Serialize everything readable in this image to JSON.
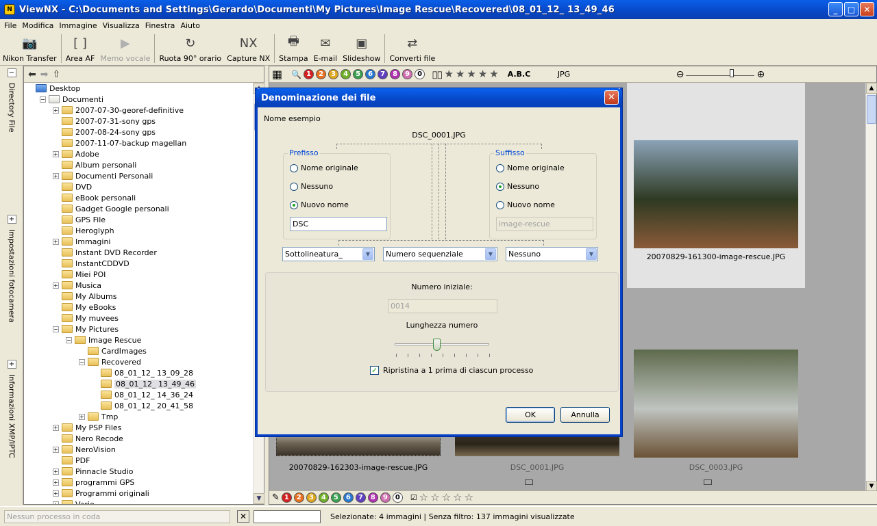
{
  "window": {
    "title": "ViewNX - C:\\Documents and Settings\\Gerardo\\Documenti\\My Pictures\\Image Rescue\\Recovered\\08_01_12_ 13_49_46",
    "app_icon": "N",
    "controls": {
      "minimize": "_",
      "maximize": "□",
      "close": "✕"
    }
  },
  "menu": [
    "File",
    "Modifica",
    "Immagine",
    "Visualizza",
    "Finestra",
    "Aiuto"
  ],
  "toolbar": [
    {
      "label": "Nikon Transfer",
      "icon": "camera-transfer-icon",
      "glyph": "📷",
      "enabled": true
    },
    {
      "label": "Area AF",
      "icon": "af-area-icon",
      "glyph": "[ ]",
      "enabled": true
    },
    {
      "label": "Memo vocale",
      "icon": "voice-memo-icon",
      "glyph": "▶",
      "enabled": false
    },
    {
      "label": "Ruota 90° orario",
      "icon": "rotate-icon",
      "glyph": "↻",
      "enabled": true
    },
    {
      "label": "Capture NX",
      "icon": "capture-nx-icon",
      "glyph": "NX",
      "enabled": true
    },
    {
      "label": "Stampa",
      "icon": "print-icon",
      "glyph": "🖶",
      "enabled": true
    },
    {
      "label": "E-mail",
      "icon": "email-icon",
      "glyph": "✉",
      "enabled": true
    },
    {
      "label": "Slideshow",
      "icon": "slideshow-icon",
      "glyph": "▣",
      "enabled": true
    },
    {
      "label": "Converti file",
      "icon": "convert-file-icon",
      "glyph": "⇄",
      "enabled": true
    }
  ],
  "left_tabs": [
    {
      "label": "Directory File",
      "toggle": "−"
    },
    {
      "label": "Impostazioni fotocamera",
      "toggle": "+"
    },
    {
      "label": "Informazioni XMP/IPTC",
      "toggle": "+"
    }
  ],
  "tree": [
    {
      "level": 0,
      "label": "Desktop",
      "exp": "",
      "icon": "desktop"
    },
    {
      "level": 1,
      "label": "Documenti",
      "exp": "−",
      "icon": "docs"
    },
    {
      "level": 2,
      "label": "2007-07-30-georef-definitive",
      "exp": "+"
    },
    {
      "level": 2,
      "label": "2007-07-31-sony gps",
      "exp": ""
    },
    {
      "level": 2,
      "label": "2007-08-24-sony gps",
      "exp": ""
    },
    {
      "level": 2,
      "label": "2007-11-07-backup magellan",
      "exp": ""
    },
    {
      "level": 2,
      "label": "Adobe",
      "exp": "+"
    },
    {
      "level": 2,
      "label": "Album personali",
      "exp": ""
    },
    {
      "level": 2,
      "label": "Documenti Personali",
      "exp": "+"
    },
    {
      "level": 2,
      "label": "DVD",
      "exp": ""
    },
    {
      "level": 2,
      "label": "eBook personali",
      "exp": ""
    },
    {
      "level": 2,
      "label": "Gadget Google personali",
      "exp": ""
    },
    {
      "level": 2,
      "label": "GPS File",
      "exp": ""
    },
    {
      "level": 2,
      "label": "Heroglyph",
      "exp": ""
    },
    {
      "level": 2,
      "label": "Immagini",
      "exp": "+"
    },
    {
      "level": 2,
      "label": "Instant DVD Recorder",
      "exp": ""
    },
    {
      "level": 2,
      "label": "InstantCDDVD",
      "exp": ""
    },
    {
      "level": 2,
      "label": "Miei POI",
      "exp": ""
    },
    {
      "level": 2,
      "label": "Musica",
      "exp": "+"
    },
    {
      "level": 2,
      "label": "My Albums",
      "exp": ""
    },
    {
      "level": 2,
      "label": "My eBooks",
      "exp": ""
    },
    {
      "level": 2,
      "label": "My muvees",
      "exp": ""
    },
    {
      "level": 2,
      "label": "My Pictures",
      "exp": "−"
    },
    {
      "level": 3,
      "label": "Image Rescue",
      "exp": "−"
    },
    {
      "level": 4,
      "label": "CardImages",
      "exp": ""
    },
    {
      "level": 4,
      "label": "Recovered",
      "exp": "−"
    },
    {
      "level": 5,
      "label": "08_01_12_ 13_09_28",
      "exp": ""
    },
    {
      "level": 5,
      "label": "08_01_12_ 13_49_46",
      "exp": "",
      "selected": true
    },
    {
      "level": 5,
      "label": "08_01_12_ 14_36_24",
      "exp": ""
    },
    {
      "level": 5,
      "label": "08_01_12_ 20_41_58",
      "exp": ""
    },
    {
      "level": 4,
      "label": "Tmp",
      "exp": "+"
    },
    {
      "level": 2,
      "label": "My PSP Files",
      "exp": "+"
    },
    {
      "level": 2,
      "label": "Nero Recode",
      "exp": ""
    },
    {
      "level": 2,
      "label": "NeroVision",
      "exp": "+"
    },
    {
      "level": 2,
      "label": "PDF",
      "exp": ""
    },
    {
      "level": 2,
      "label": "Pinnacle Studio",
      "exp": "+"
    },
    {
      "level": 2,
      "label": "programmi GPS",
      "exp": "+"
    },
    {
      "level": 2,
      "label": "Programmi originali",
      "exp": "+"
    },
    {
      "level": 2,
      "label": "Varie",
      "exp": "+"
    }
  ],
  "browser_toolbar": {
    "labels": [
      "1",
      "2",
      "3",
      "4",
      "5",
      "6",
      "7",
      "8",
      "9",
      "0"
    ],
    "label_colors": [
      "#d42020",
      "#e87020",
      "#e0a820",
      "#70b028",
      "#3aa050",
      "#2878d0",
      "#6040c0",
      "#b030b0",
      "#d070b0",
      "#ffffff"
    ],
    "abc": "A.B.C",
    "format": "JPG",
    "star_glyph": "★",
    "zoom_out": "⊖",
    "zoom_in": "⊕"
  },
  "photos": [
    {
      "name": "20070829-161300-image-rescue.JPG",
      "dim": false,
      "palette": [
        "#8ba3b8",
        "#2e3a22",
        "#8a5a38"
      ]
    },
    {
      "name": "20070829-162303-image-rescue.JPG",
      "dim": false,
      "palette": [
        "#c9c3b4",
        "#6b6152",
        "#3a3228"
      ]
    },
    {
      "name": "DSC_0001.JPG",
      "dim": true,
      "palette": [
        "#4a3e30",
        "#2a2418",
        "#7a6a52"
      ]
    },
    {
      "name": "DSC_0003.JPG",
      "dim": true,
      "palette": [
        "#5e6a4c",
        "#bfc4c0",
        "#6b5236"
      ]
    }
  ],
  "bottom_strip": {
    "labels": [
      "1",
      "2",
      "3",
      "4",
      "5",
      "6",
      "7",
      "8",
      "9",
      "0"
    ],
    "star_glyph": "☆"
  },
  "status": {
    "queue_placeholder": "Nessun processo in coda",
    "cancel": "✕",
    "selection": "Selezionate: 4 immagini | Senza filtro: 137 immagini visualizzate"
  },
  "dialog": {
    "title": "Denominazione dei file",
    "close": "✕",
    "example_label": "Nome esempio",
    "example_value": "DSC_0001.JPG",
    "prefix": {
      "legend": "Prefisso",
      "options": [
        "Nome originale",
        "Nessuno",
        "Nuovo nome"
      ],
      "selected": 2,
      "value": "DSC"
    },
    "suffix": {
      "legend": "Suffisso",
      "options": [
        "Nome originale",
        "Nessuno",
        "Nuovo nome"
      ],
      "selected": 1,
      "value": "image-rescue"
    },
    "separator": "Sottolineatura_",
    "numbering": "Numero sequenziale",
    "suffix_separator": "Nessuno",
    "start_number_label": "Numero iniziale:",
    "start_number": "0014",
    "length_label": "Lunghezza numero",
    "length_level": 0.44,
    "reset_checkbox": "Ripristina a 1 prima di ciascun processo",
    "reset_checked": true,
    "ok": "OK",
    "cancel": "Annulla"
  }
}
